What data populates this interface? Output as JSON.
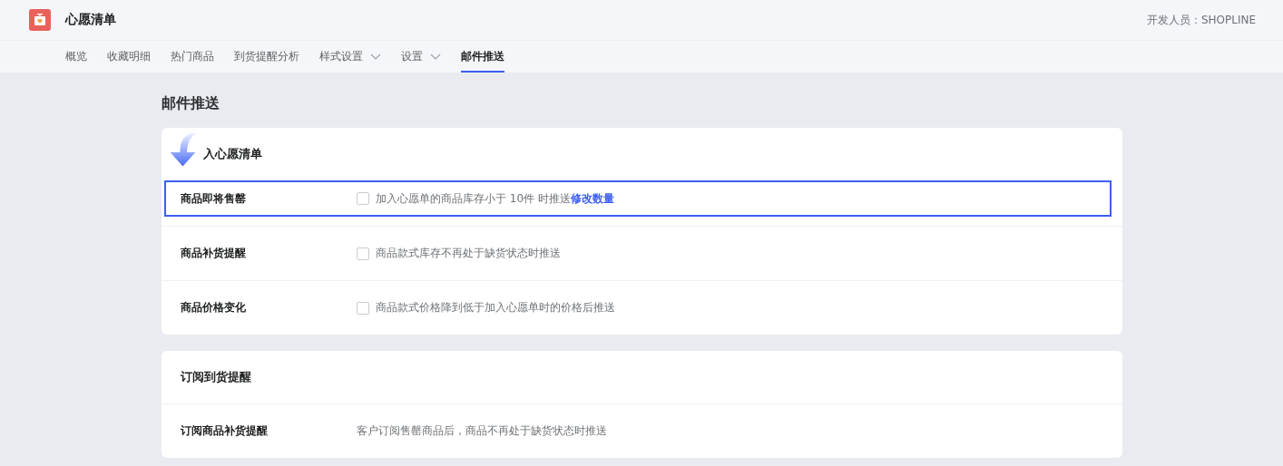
{
  "app": {
    "title": "心愿清单",
    "developer": "开发人员：SHOPLINE"
  },
  "tabs": [
    {
      "label": "概览",
      "selected": false,
      "dropdown": false
    },
    {
      "label": "收藏明细",
      "selected": false,
      "dropdown": false
    },
    {
      "label": "热门商品",
      "selected": false,
      "dropdown": false
    },
    {
      "label": "到货提醒分析",
      "selected": false,
      "dropdown": false
    },
    {
      "label": "样式设置",
      "selected": false,
      "dropdown": true
    },
    {
      "label": "设置",
      "selected": false,
      "dropdown": true
    },
    {
      "label": "邮件推送",
      "selected": true,
      "dropdown": false
    }
  ],
  "page_title": "邮件推送",
  "sections": [
    {
      "title": "入心愿清单",
      "pointer_arrow": true,
      "rows": [
        {
          "kind": "checkbox",
          "label": "商品即将售罄",
          "checked": false,
          "highlighted": true,
          "text": "加入心愿单的商品库存小于 10件 时推送",
          "link": "修改数量"
        },
        {
          "kind": "checkbox",
          "label": "商品补货提醒",
          "checked": false,
          "highlighted": false,
          "text": "商品款式库存不再处于缺货状态时推送"
        },
        {
          "kind": "checkbox",
          "label": "商品价格变化",
          "checked": false,
          "highlighted": false,
          "text": "商品款式价格降到低于加入心愿单时的价格后推送"
        }
      ]
    },
    {
      "title": "订阅到货提醒",
      "pointer_arrow": false,
      "rows": [
        {
          "kind": "plain",
          "label": "订阅商品补货提醒",
          "highlighted": false,
          "text": "客户订阅售罄商品后，商品不再处于缺货状态时推送"
        }
      ]
    }
  ]
}
